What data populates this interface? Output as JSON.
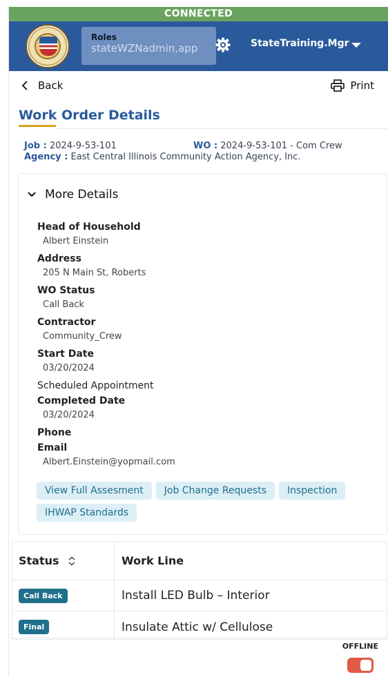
{
  "connection": {
    "status": "CONNECTED",
    "color": "#6aa360"
  },
  "header": {
    "bg_color": "#2a5a9c",
    "seal_icon": "state-seal-icon",
    "roles_label": "Roles",
    "roles_value": "stateWZNadmin,app",
    "user_name": "StateTraining.Mgr"
  },
  "nav": {
    "back_label": "Back",
    "print_label": "Print"
  },
  "page": {
    "title": "Work Order Details"
  },
  "job": {
    "job_label": "Job :",
    "job_value": "2024-9-53-101",
    "wo_label": "WO :",
    "wo_value": "2024-9-53-101 - Com Crew",
    "agency_label": "Agency :",
    "agency_value": "East Central Illinois Community Action Agency, Inc."
  },
  "details": {
    "toggle_label": "More Details",
    "fields": [
      {
        "label": "Head of Household",
        "value": "Albert Einstein"
      },
      {
        "label": "Address",
        "value": "205 N Main St, Roberts"
      },
      {
        "label": "WO Status",
        "value": "Call Back"
      },
      {
        "label": "Contractor",
        "value": "Community_Crew"
      },
      {
        "label": "Start Date",
        "value": "03/20/2024"
      },
      {
        "label": "Scheduled Appointment",
        "value": ""
      },
      {
        "label": "Completed Date",
        "value": "03/20/2024"
      },
      {
        "label": "Phone",
        "value": ""
      },
      {
        "label": "Email",
        "value": "Albert.Einstein@yopmail.com"
      }
    ],
    "actions": [
      "View Full Assesment",
      "Job Change Requests",
      "Inspection",
      "IHWAP Standards"
    ]
  },
  "table": {
    "headers": {
      "status": "Status",
      "work_line": "Work Line"
    },
    "rows": [
      {
        "status": "Call Back",
        "work_line": "Install LED Bulb – Interior"
      },
      {
        "status": "Final",
        "work_line": "Insulate Attic w/ Cellulose"
      }
    ]
  },
  "offline": {
    "label": "OFFLINE",
    "toggle_color": "#e05a47"
  }
}
